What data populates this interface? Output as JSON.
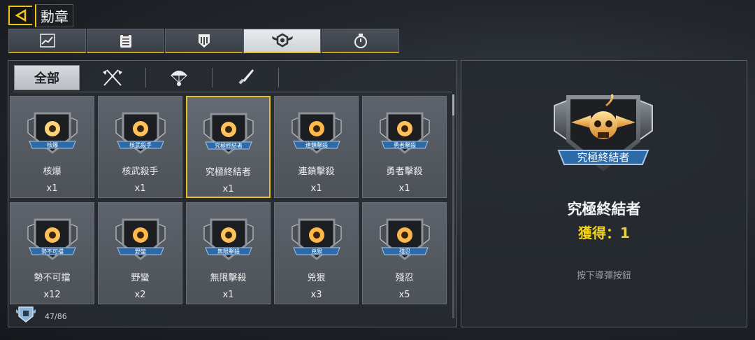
{
  "header": {
    "title": "勳章"
  },
  "top_tabs": [
    {
      "icon": "chart-icon"
    },
    {
      "icon": "clipboard-icon"
    },
    {
      "icon": "shield-map-icon"
    },
    {
      "icon": "medal-wings-icon",
      "active": true
    },
    {
      "icon": "stopwatch-icon"
    }
  ],
  "sub_tabs": [
    {
      "label": "全部",
      "active": true
    },
    {
      "icon": "crossed-flags-icon"
    },
    {
      "icon": "parachute-icon"
    },
    {
      "icon": "knife-icon"
    }
  ],
  "medals": [
    {
      "name": "核爆",
      "banner": "核爆",
      "count": "x1",
      "icon": "nuke-badge-icon"
    },
    {
      "name": "核武殺手",
      "banner": "核武殺手",
      "count": "x1",
      "icon": "radiation-badge-icon"
    },
    {
      "name": "究極終結者",
      "banner": "究極終結者",
      "count": "x1",
      "icon": "skull-wings-badge-icon",
      "selected": true
    },
    {
      "name": "連鎖擊殺",
      "banner": "連鎖擊殺",
      "count": "x1",
      "icon": "star-wings-badge-icon"
    },
    {
      "name": "勇者擊殺",
      "banner": "勇者擊殺",
      "count": "x1",
      "icon": "eight-badge-icon"
    },
    {
      "name": "勢不可擋",
      "banner": "勢不可擋",
      "count": "x12",
      "icon": "hourglass-badge-icon"
    },
    {
      "name": "野蠻",
      "banner": "野蠻",
      "count": "x2",
      "icon": "beast-badge-icon"
    },
    {
      "name": "無限擊殺",
      "banner": "無限擊殺",
      "count": "x1",
      "icon": "seven-badge-icon"
    },
    {
      "name": "兇狠",
      "banner": "兇狠",
      "count": "x3",
      "icon": "shield-badge-icon"
    },
    {
      "name": "殘忍",
      "banner": "殘忍",
      "count": "x5",
      "icon": "stripes-badge-icon"
    }
  ],
  "footer": {
    "progress": "47/86"
  },
  "detail": {
    "name": "究極終結者",
    "banner": "究極終結者",
    "acquired": "獲得：1",
    "hint": "按下導彈按鈕"
  },
  "colors": {
    "accent": "#f0c419",
    "selected_border": "#e8c21c",
    "acquired_text": "#f0d21f"
  }
}
